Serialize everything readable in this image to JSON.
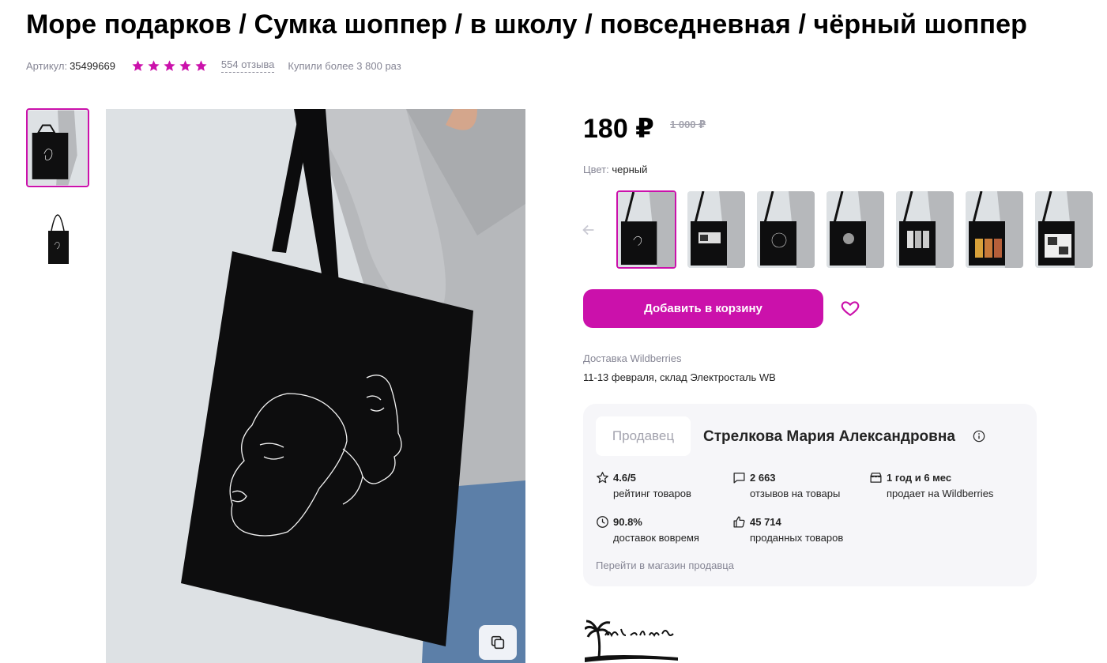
{
  "product": {
    "title": "Море подарков / Сумка шоппер / в школу / повседневная / чёрный шоппер",
    "sku_label": "Артикул:",
    "sku": "35499669",
    "rating_stars": 5,
    "reviews_link": "554 отзыва",
    "bought": "Купили более 3 800 раз"
  },
  "gallery": {
    "thumbnails": [
      "model-with-black-bag",
      "black-bag-flat"
    ],
    "zoom_icon": "copy-icon"
  },
  "pricing": {
    "price": "180 ₽",
    "old_price": "1 000 ₽"
  },
  "color": {
    "label": "Цвет:",
    "value": "черный",
    "variants": [
      "line-faces",
      "text-print",
      "line-drawing",
      "portrait",
      "anime-print",
      "manga-print",
      "comic-print"
    ]
  },
  "actions": {
    "add_to_cart": "Добавить в корзину",
    "favorite_icon": "heart-icon"
  },
  "delivery": {
    "label": "Доставка Wildberries",
    "value": "11-13 февраля, склад Электросталь WB"
  },
  "seller": {
    "tag": "Продавец",
    "name": "Стрелкова Мария Александровна",
    "stats": [
      {
        "icon": "star-outline-icon",
        "value": "4.6/5",
        "label": "рейтинг товаров"
      },
      {
        "icon": "chat-icon",
        "value": "2 663",
        "label": "отзывов на товары"
      },
      {
        "icon": "shop-icon",
        "value": "1 год и 6 мес",
        "label": "продает на Wildberries"
      },
      {
        "icon": "clock-icon",
        "value": "90.8%",
        "label": "доставок вовремя"
      },
      {
        "icon": "thumbs-up-icon",
        "value": "45 714",
        "label": "проданных товаров"
      }
    ],
    "store_link": "Перейти в магазин продавца"
  },
  "brand": {
    "logo_text": "Море подарков"
  },
  "colors": {
    "accent": "#cb11ab",
    "muted_text": "#868695",
    "card_bg": "#f6f6f9"
  }
}
